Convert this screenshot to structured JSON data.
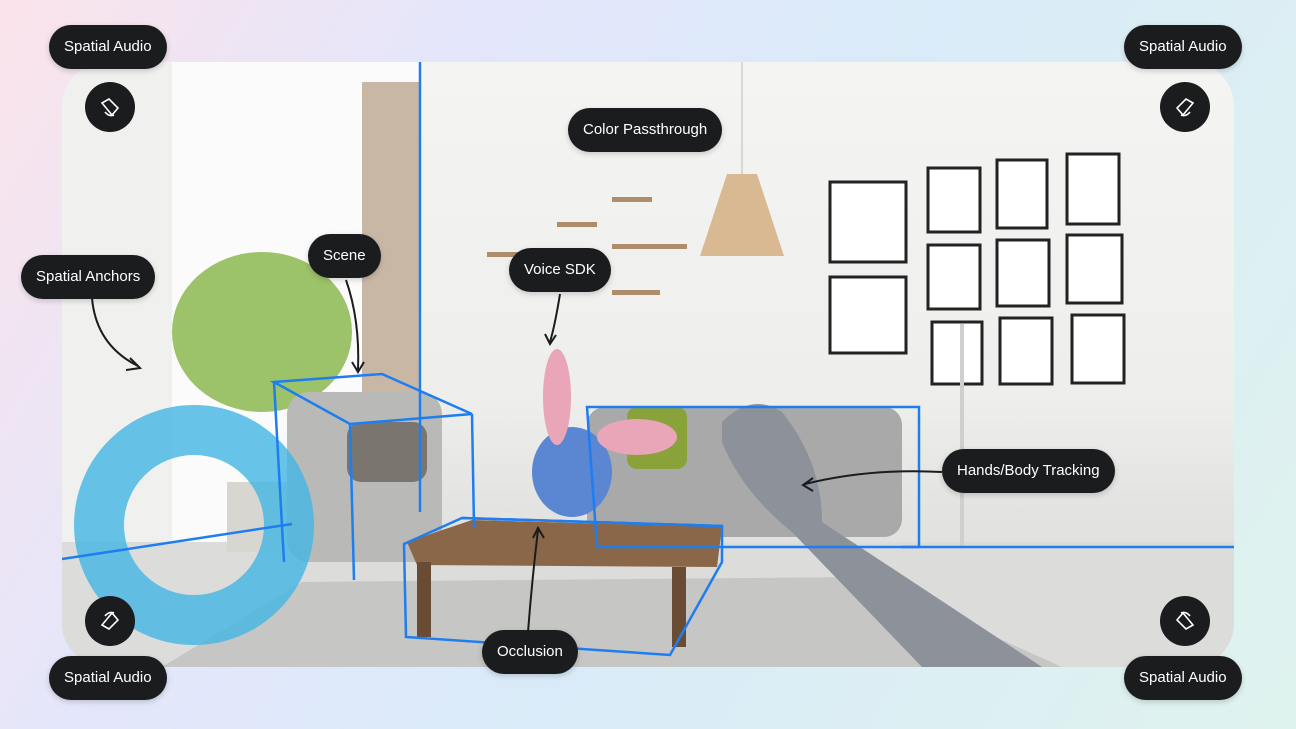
{
  "labels": {
    "spatial_audio_top_left": "Spatial Audio",
    "spatial_audio_top_right": "Spatial Audio",
    "spatial_audio_bottom_left": "Spatial Audio",
    "spatial_audio_bottom_right": "Spatial Audio",
    "color_passthrough": "Color Passthrough",
    "scene": "Scene",
    "spatial_anchors": "Spatial Anchors",
    "voice_sdk": "Voice SDK",
    "hands_body_tracking": "Hands/Body Tracking",
    "occlusion": "Occlusion"
  },
  "icons": [
    "speaker-icon",
    "speaker-icon",
    "speaker-icon",
    "speaker-icon"
  ],
  "colors": {
    "accent_blue": "#1e7ef0",
    "label_bg": "#1b1c1e",
    "label_text": "#ffffff"
  }
}
